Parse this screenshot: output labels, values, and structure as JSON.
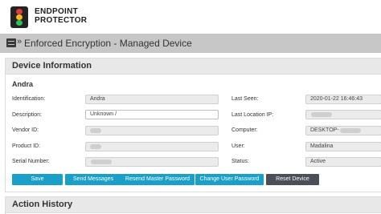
{
  "brand": {
    "line1": "ENDPOINT",
    "line2": "PROTECTOR"
  },
  "title_bar": {
    "title": "Enforced Encryption - Managed Device"
  },
  "device_info": {
    "header": "Device Information",
    "device_name": "Andra",
    "fields": {
      "identification": {
        "label": "Identification:",
        "value": "Andra"
      },
      "description": {
        "label": "Description:",
        "value": "Unknown /"
      },
      "vendor_id": {
        "label": "Vendor ID:",
        "value": ""
      },
      "product_id": {
        "label": "Product ID:",
        "value": ""
      },
      "serial_number": {
        "label": "Serial Number:",
        "value": ""
      },
      "last_seen": {
        "label": "Last Seen:",
        "value": "2020-01-22 16:46:43"
      },
      "last_location_ip": {
        "label": "Last Location IP:",
        "value": ""
      },
      "computer": {
        "label": "Computer:",
        "value": "DESKTOP-"
      },
      "user": {
        "label": "User:",
        "value": "Madalina"
      },
      "status": {
        "label": "Status:",
        "value": "Active"
      }
    },
    "buttons": {
      "save": "Save",
      "send_messages": "Send Messages",
      "resend_master_password": "Resend Master Password",
      "change_user_password": "Change User Password",
      "reset_device": "Reset Device"
    }
  },
  "action_history": {
    "header": "Action History"
  },
  "colors": {
    "primary_button": "#1aa0c8",
    "dark_button": "#4b4f57",
    "title_bar": "#c7c7c7",
    "panel_header": "#e8e8e8"
  },
  "icons": {
    "logo": "traffic-light-logo-icon",
    "menu": "menu-list-icon"
  }
}
